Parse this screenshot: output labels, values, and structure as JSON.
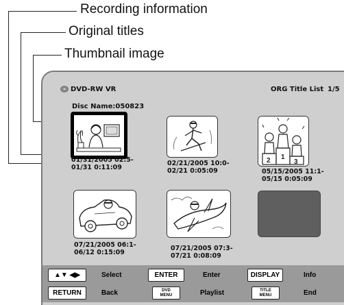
{
  "callouts": {
    "recording_information": "Recording information",
    "original_titles": "Original titles",
    "thumbnail_image": "Thumbnail image"
  },
  "header": {
    "disc_type": "DVD-RW VR",
    "list_title": "ORG Title List",
    "page": "1/5",
    "disc_name": "Disc Name:050823",
    "disc_icon": "disc-icon"
  },
  "titles": [
    {
      "line1": "01/31/2005 02:5-",
      "line2": "01/31 0:11:09",
      "thumbnail": "woman-at-desk",
      "selected": true
    },
    {
      "line1": "02/21/2005 10:0-",
      "line2": "02/21 0:05:09",
      "thumbnail": "skier"
    },
    {
      "line1": "05/15/2005 11:1-",
      "line2": "05/15 0:05:09",
      "thumbnail": "podium-winners"
    },
    {
      "line1": "07/21/2005 06:1-",
      "line2": "06/12 0:15:09",
      "thumbnail": "car-driver"
    },
    {
      "line1": "07/21/2005 07:3-",
      "line2": "07/21 0:08:09",
      "thumbnail": "airplane-pilot"
    },
    {
      "line1": "",
      "line2": "",
      "thumbnail": "empty"
    }
  ],
  "buttons": {
    "arrows_key": "▲▼ ◀▶",
    "select_label": "Select",
    "enter_key": "ENTER",
    "enter_label": "Enter",
    "display_key": "DISPLAY",
    "info_label": "Info",
    "return_key": "RETURN",
    "back_label": "Back",
    "dvd_menu_key_line1": "DVD",
    "dvd_menu_key_line2": "MENU",
    "playlist_label": "Playlist",
    "title_menu_key_line1": "TITLE",
    "title_menu_key_line2": "MENU",
    "end_label": "End"
  },
  "colors": {
    "screen_bg": "#cfcfcf",
    "button_bar": "#9a9a9a",
    "empty_thumb": "#5f5f5f"
  }
}
